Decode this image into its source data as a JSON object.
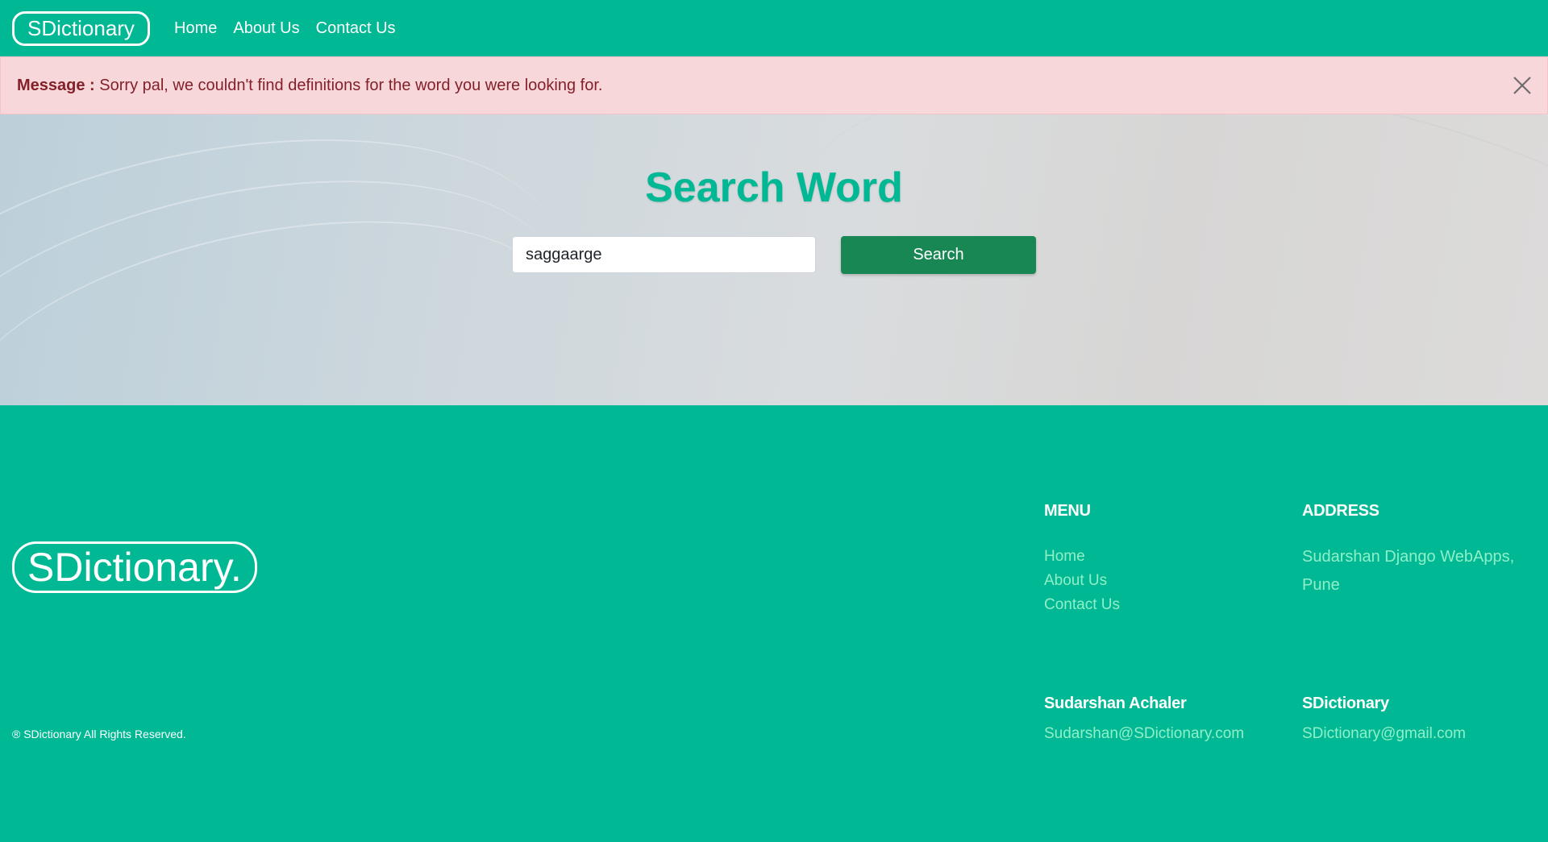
{
  "navbar": {
    "brand": "SDictionary",
    "links": [
      "Home",
      "About Us",
      "Contact Us"
    ]
  },
  "alert": {
    "label": "Message :",
    "text": "Sorry pal, we couldn't find definitions for the word you were looking for."
  },
  "search": {
    "title": "Search Word",
    "value": "saggaarge",
    "button": "Search"
  },
  "footer": {
    "brand": "SDictionary.",
    "copyright": "® SDictionary All Rights Reserved.",
    "menu": {
      "heading": "MENU",
      "links": [
        "Home",
        "About Us",
        "Contact Us"
      ]
    },
    "address": {
      "heading": "ADDRESS",
      "line1": "Sudarshan Django WebApps,",
      "line2": "Pune"
    },
    "contact1": {
      "name": "Sudarshan Achaler",
      "email": "Sudarshan@SDictionary.com"
    },
    "contact2": {
      "name": "SDictionary",
      "email": "SDictionary@gmail.com"
    }
  },
  "colors": {
    "primary": "#00b894",
    "button": "#198754",
    "alert_bg": "#f8d7da",
    "alert_text": "#842029",
    "footer_link": "#8ff0c8"
  }
}
